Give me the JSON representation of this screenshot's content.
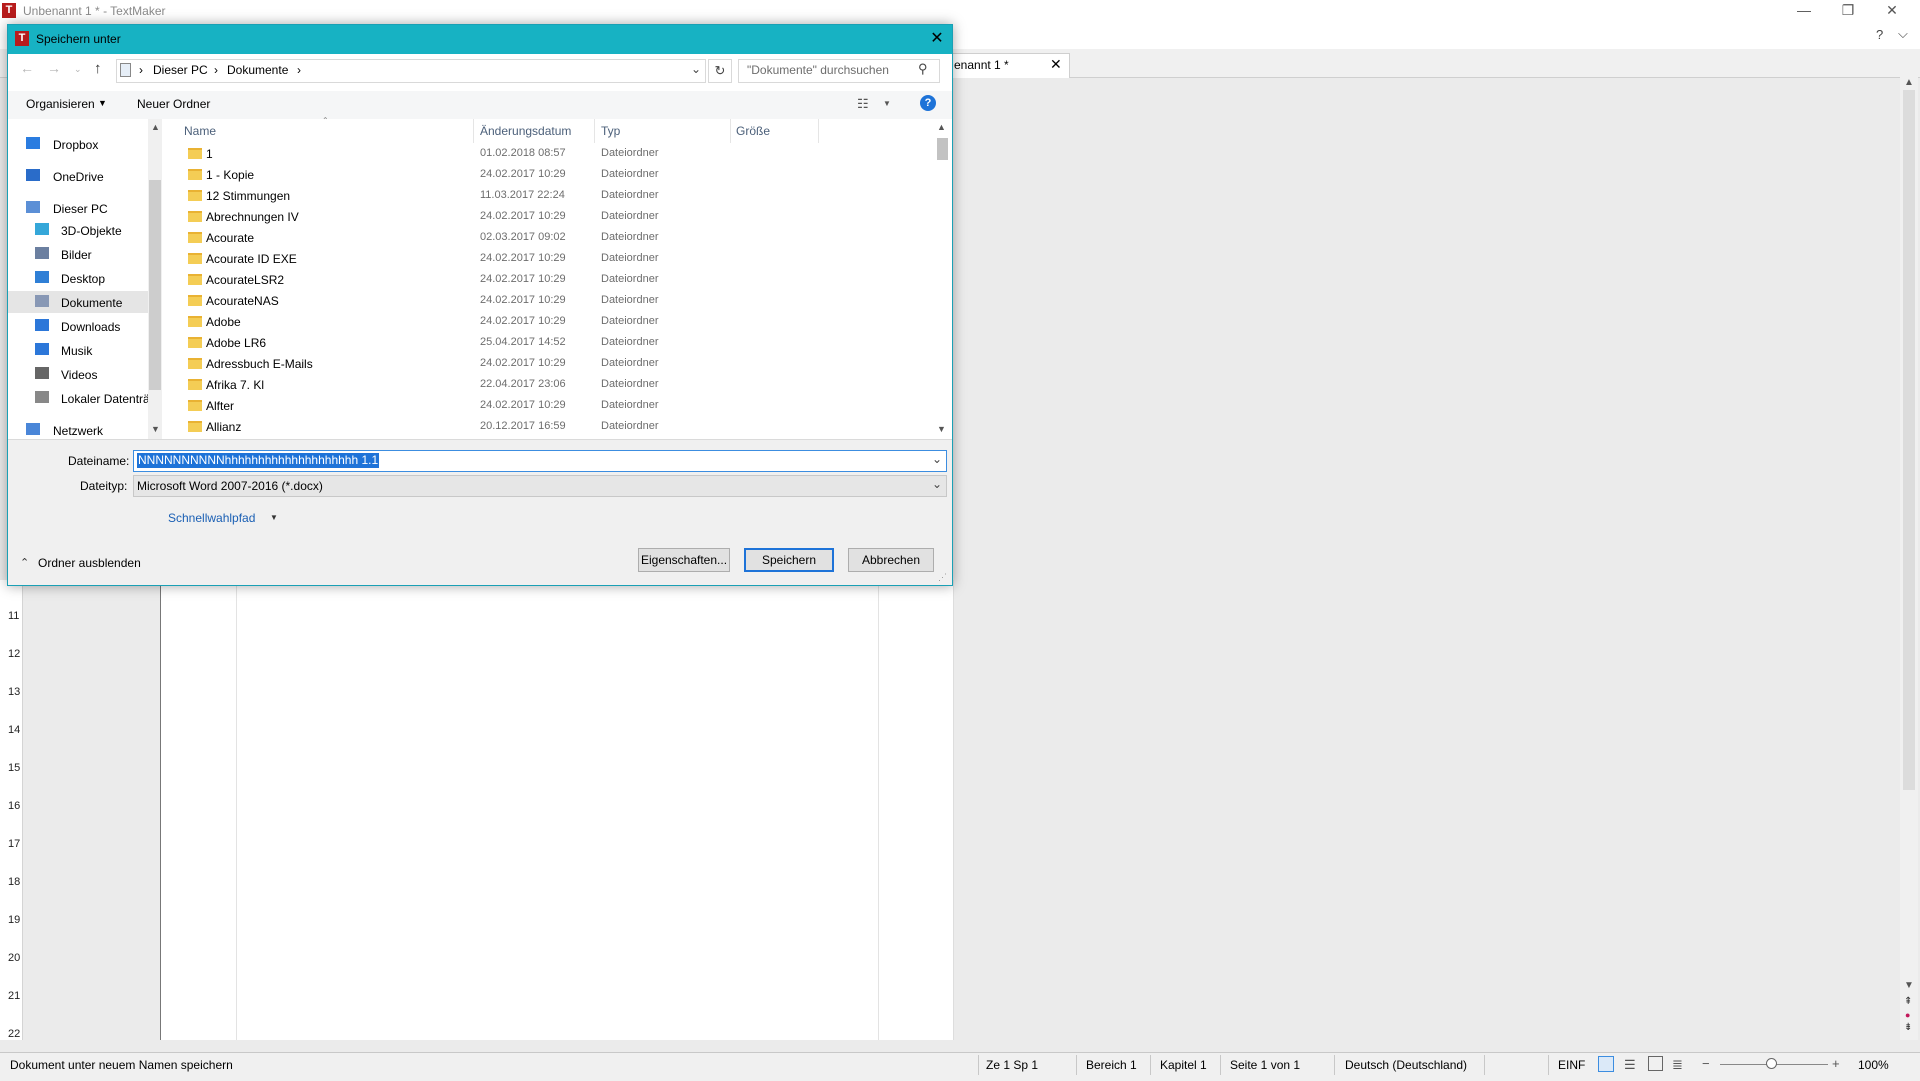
{
  "window": {
    "title": "Unbenannt 1 * - TextMaker",
    "logo_letter": "T",
    "controls": [
      "—",
      "❐",
      "✕"
    ],
    "menu_right": [
      "?",
      "⌵"
    ]
  },
  "document_tab": {
    "label": "enannt 1 *",
    "close": "✕"
  },
  "vertical_ruler": [
    "11",
    "12",
    "13",
    "14",
    "15",
    "16",
    "17",
    "18",
    "19",
    "20",
    "21",
    "22"
  ],
  "dialog": {
    "title": "Speichern unter",
    "logo_letter": "T",
    "close": "✕",
    "address": {
      "root_icon": "pc-icon",
      "crumbs": [
        "Dieser PC",
        "Dokumente"
      ],
      "sep": "›"
    },
    "search_placeholder": "\"Dokumente\" durchsuchen",
    "toolbar": {
      "organize": "Organisieren",
      "new_folder": "Neuer Ordner",
      "help": "?"
    },
    "nav": [
      {
        "label": "Dropbox",
        "icon": "dropbox-icon",
        "indent": 0
      },
      {
        "label": "OneDrive",
        "icon": "onedrive-icon",
        "indent": 0
      },
      {
        "label": "Dieser PC",
        "icon": "pc-icon",
        "indent": 0
      },
      {
        "label": "3D-Objekte",
        "icon": "cube-icon",
        "indent": 1
      },
      {
        "label": "Bilder",
        "icon": "pictures-icon",
        "indent": 1
      },
      {
        "label": "Desktop",
        "icon": "desktop-icon",
        "indent": 1
      },
      {
        "label": "Dokumente",
        "icon": "documents-icon",
        "indent": 1,
        "selected": true
      },
      {
        "label": "Downloads",
        "icon": "download-icon",
        "indent": 1
      },
      {
        "label": "Musik",
        "icon": "music-icon",
        "indent": 1
      },
      {
        "label": "Videos",
        "icon": "video-icon",
        "indent": 1
      },
      {
        "label": "Lokaler Datenträ",
        "icon": "drive-icon",
        "indent": 1
      },
      {
        "label": "Netzwerk",
        "icon": "network-icon",
        "indent": 0
      }
    ],
    "columns": {
      "name": "Name",
      "date": "Änderungsdatum",
      "type": "Typ",
      "size": "Größe"
    },
    "files": [
      {
        "name": "1",
        "date": "01.02.2018 08:57",
        "type": "Dateiordner"
      },
      {
        "name": "1 - Kopie",
        "date": "24.02.2017 10:29",
        "type": "Dateiordner"
      },
      {
        "name": "12 Stimmungen",
        "date": "11.03.2017 22:24",
        "type": "Dateiordner"
      },
      {
        "name": "Abrechnungen IV",
        "date": "24.02.2017 10:29",
        "type": "Dateiordner"
      },
      {
        "name": "Acourate",
        "date": "02.03.2017 09:02",
        "type": "Dateiordner"
      },
      {
        "name": "Acourate ID EXE",
        "date": "24.02.2017 10:29",
        "type": "Dateiordner"
      },
      {
        "name": "AcourateLSR2",
        "date": "24.02.2017 10:29",
        "type": "Dateiordner"
      },
      {
        "name": "AcourateNAS",
        "date": "24.02.2017 10:29",
        "type": "Dateiordner"
      },
      {
        "name": "Adobe",
        "date": "24.02.2017 10:29",
        "type": "Dateiordner"
      },
      {
        "name": "Adobe LR6",
        "date": "25.04.2017 14:52",
        "type": "Dateiordner"
      },
      {
        "name": "Adressbuch E-Mails",
        "date": "24.02.2017 10:29",
        "type": "Dateiordner"
      },
      {
        "name": "Afrika 7. Kl",
        "date": "22.04.2017 23:06",
        "type": "Dateiordner"
      },
      {
        "name": "Alfter",
        "date": "24.02.2017 10:29",
        "type": "Dateiordner"
      },
      {
        "name": "Allianz",
        "date": "20.12.2017 16:59",
        "type": "Dateiordner"
      }
    ],
    "filename_label": "Dateiname:",
    "filename_value": "NNNNNNNNNNhhhhhhhhhhhhhhhhhhhh 1.1",
    "filetype_label": "Dateityp:",
    "filetype_value": "Microsoft Word 2007-2016 (*.docx)",
    "quick_path": "Schnellwahlpfad",
    "hide_folders": "Ordner ausblenden",
    "buttons": {
      "properties": "Eigenschaften...",
      "save": "Speichern",
      "cancel": "Abbrechen"
    }
  },
  "statusbar": {
    "message": "Dokument unter neuem Namen speichern",
    "position": "Ze 1 Sp 1",
    "section": "Bereich 1",
    "chapter": "Kapitel 1",
    "page": "Seite 1 von 1",
    "language": "Deutsch (Deutschland)",
    "mode": "EINF",
    "zoom": "100%"
  }
}
